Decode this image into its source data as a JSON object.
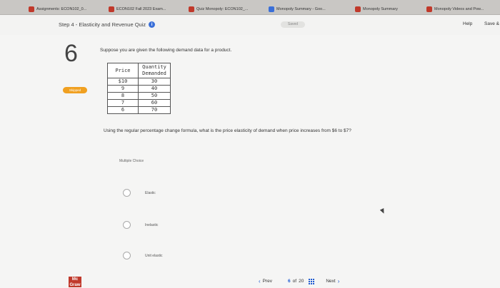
{
  "tabs": [
    {
      "label": "Assignments: ECON102_0...",
      "icon": "mcgraw-icon",
      "color": "#c0392b"
    },
    {
      "label": "ECON102 Fall 2023 Exam...",
      "icon": "mcgraw-icon",
      "color": "#c0392b"
    },
    {
      "label": "Quiz Monopoly: ECON102_...",
      "icon": "mcgraw-icon",
      "color": "#c0392b"
    },
    {
      "label": "Monopoly Summary - Goo...",
      "icon": "google-docs-icon",
      "color": "#3a6fd8"
    },
    {
      "label": "Monopoly Summary",
      "icon": "mcgraw-icon",
      "color": "#c0392b"
    },
    {
      "label": "Monopoly Videos and Pow...",
      "icon": "mcgraw-icon",
      "color": "#c0392b"
    }
  ],
  "header": {
    "title": "Step 4 - Elasticity and Revenue Quiz",
    "info_icon": "i",
    "saved": "Saved",
    "help": "Help",
    "save_exit": "Save &"
  },
  "question": {
    "number": "6",
    "status": "Skipped",
    "prompt": "Suppose you are given the following demand data for a product.",
    "table": {
      "headers": {
        "price": "Price",
        "quantity_line1": "Quantity",
        "quantity_line2": "Demanded"
      },
      "rows": [
        {
          "price": "$10",
          "quantity": "30"
        },
        {
          "price": "9",
          "quantity": "40"
        },
        {
          "price": "8",
          "quantity": "50"
        },
        {
          "price": "7",
          "quantity": "60"
        },
        {
          "price": "6",
          "quantity": "70"
        }
      ]
    },
    "text": "Using the regular percentage change formula, what is the price elasticity of demand when price increases from $6 to $7?",
    "choice_type": "Multiple Choice",
    "options": [
      "Elastic",
      "Inelastic",
      "Unit elastic"
    ]
  },
  "footer": {
    "logo": "Mc Graw",
    "prev": "Prev",
    "page_current": "6",
    "page_of": "of",
    "page_total": "20",
    "next": "Next"
  }
}
